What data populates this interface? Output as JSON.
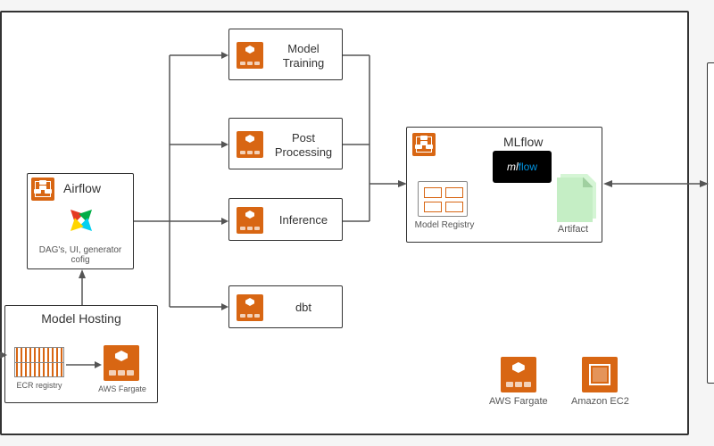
{
  "boundary": {
    "label": ""
  },
  "airflow": {
    "title": "Airflow",
    "subtitle": "DAG's, UI, generator cofig"
  },
  "model_hosting": {
    "title": "Model Hosting",
    "ecr_label": "ECR registry",
    "fargate_label": "AWS Fargate"
  },
  "tasks": {
    "model_training": "Model Training",
    "post_processing": "Post Processing",
    "inference": "Inference",
    "dbt": "dbt"
  },
  "mlflow": {
    "title": "MLflow",
    "logo_ml": "ml",
    "logo_flow": "flow",
    "registry_label": "Model Registry",
    "artifact_label": "Artifact"
  },
  "footer": {
    "fargate": "AWS Fargate",
    "ec2": "Amazon EC2"
  }
}
